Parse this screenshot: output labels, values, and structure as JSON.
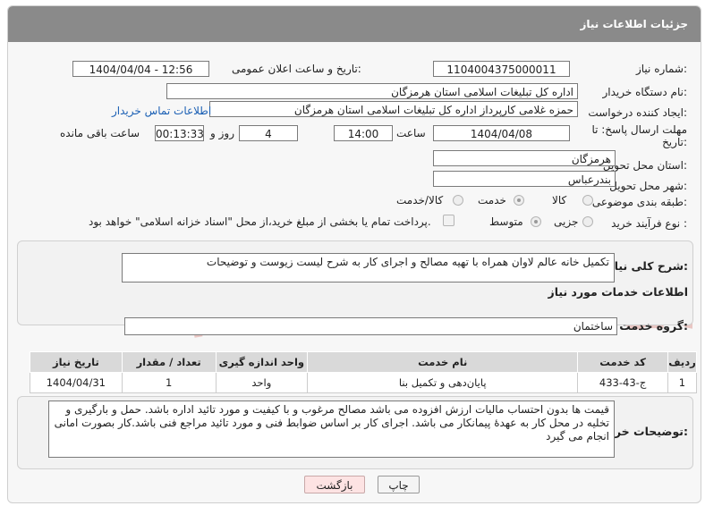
{
  "header": {
    "title": "جزئیات اطلاعات نیاز"
  },
  "fields": {
    "need_number_label": "شماره نیاز:",
    "need_number": "1104004375000011",
    "announce_label": "تاریخ و ساعت اعلان عمومی:",
    "announce_value": "1404/04/04 - 12:56",
    "buyer_org_label": "نام دستگاه خریدار:",
    "buyer_org": "اداره کل تبلیغات اسلامی استان هرمزگان",
    "requester_label": "ایجاد کننده درخواست:",
    "requester": "حمزه غلامی کارپرداز اداره کل تبلیغات اسلامی استان هرمزگان",
    "contact_link": "اطلاعات تماس خریدار",
    "deadline_label_1": "مهلت ارسال پاسخ: تا",
    "deadline_label_2": "تاریخ:",
    "deadline_date": "1404/04/08",
    "time_label": "ساعت",
    "deadline_time": "14:00",
    "days_value": "4",
    "days_label": "روز و",
    "remaining_time": "00:13:33",
    "remaining_label": "ساعت باقی مانده",
    "province_label": "استان محل تحویل:",
    "province": "هرمزگان",
    "city_label": "شهر محل تحویل:",
    "city": "بندرعباس",
    "category_label": "طبقه بندی موضوعی:",
    "category_options": [
      "کالا",
      "خدمت",
      "کالا/خدمت"
    ],
    "category_selected": "خدمت",
    "process_label": "نوع فرآیند خرید :",
    "process_options": [
      "جزیی",
      "متوسط"
    ],
    "process_selected": "متوسط",
    "payment_note": "پرداخت تمام یا بخشی از مبلغ خرید،از محل \"اسناد خزانه اسلامی\" خواهد بود."
  },
  "summary": {
    "label": "شرح کلی نیاز:",
    "text": "تکمیل خانه عالم لاوان همراه با تهیه مصالح و اجرای کار به شرح لیست زیوست و توضیحات"
  },
  "services": {
    "title": "اطلاعات خدمات مورد نیاز",
    "group_label": "گروه خدمت:",
    "group_value": "ساختمان",
    "columns": [
      "ردیف",
      "کد خدمت",
      "نام خدمت",
      "واحد اندازه گیری",
      "تعداد / مقدار",
      "تاریخ نیاز"
    ],
    "rows": [
      {
        "index": "1",
        "code": "ج-43-433",
        "name": "پایان‌دهی و تکمیل بنا",
        "unit": "واحد",
        "qty": "1",
        "date": "1404/04/31"
      }
    ]
  },
  "buyer_notes": {
    "label": "توضیحات خریدار:",
    "text": "قیمت ها بدون احتساب مالیات ارزش افزوده می باشد مصالح مرغوب و با کیفیت و مورد تائید اداره باشد. حمل و بارگیری و تخلیه در محل کار به عهدۀ پیمانکار می باشد.      اجرای کار بر اساس ضوابط فنی و مورد تائید مراجع فنی باشد.کار بصورت امانی انجام می گیرد"
  },
  "buttons": {
    "print": "چاپ",
    "back": "بازگشت"
  },
  "watermark": {
    "text": "AriaTender.neT"
  },
  "colors": {
    "header_bg": "#8a8a8a",
    "link": "#1a5fb4",
    "back_button_bg": "#fde3e3",
    "watermark": "#c0392b"
  }
}
